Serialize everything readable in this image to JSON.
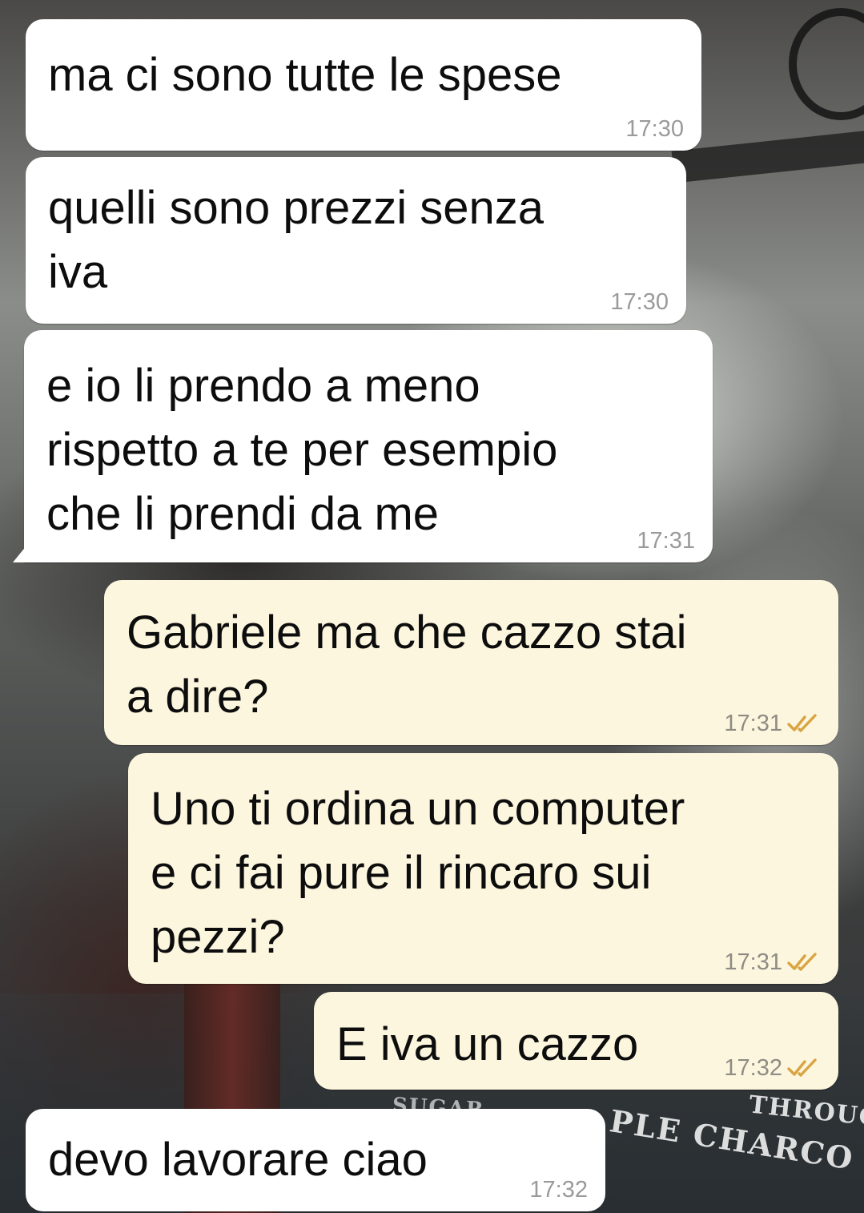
{
  "messages": [
    {
      "text": "ma ci sono tutte le spese",
      "time": "17:30"
    },
    {
      "text": "quelli sono prezzi senza\niva",
      "time": "17:30"
    },
    {
      "text": "e io li prendo a meno\nrispetto a te per esempio\nche li prendi da me",
      "time": "17:31"
    },
    {
      "text": "Gabriele ma che cazzo stai\na dire?",
      "time": "17:31",
      "status_icon": "read-ticks"
    },
    {
      "text": "Uno ti ordina un computer\ne ci fai pure il rincaro sui\npezzi?",
      "time": "17:31",
      "status_icon": "read-ticks"
    },
    {
      "text": "E iva un cazzo",
      "time": "17:32",
      "status_icon": "read-ticks"
    },
    {
      "text": "devo lavorare ciao",
      "time": "17:32"
    }
  ],
  "wallpaper_text": {
    "a": "SUGAR",
    "b": "THROUG",
    "c": "PLE CHARCO"
  },
  "colors": {
    "incoming_bubble": "#ffffff",
    "outgoing_bubble": "#fcf6de",
    "tick": "#d9a441",
    "time": "#9a9a9a"
  }
}
